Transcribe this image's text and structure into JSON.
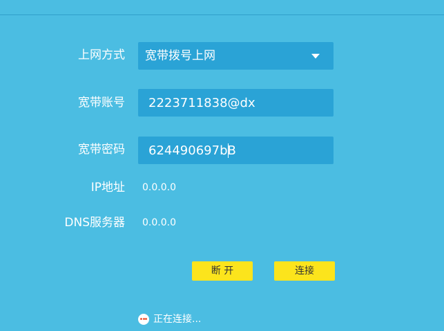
{
  "form": {
    "connection_type": {
      "label": "上网方式",
      "value": "宽带拨号上网"
    },
    "account": {
      "label": "宽带账号",
      "value": "2223711838@dx"
    },
    "password": {
      "label": "宽带密码",
      "value": "624490697bB"
    },
    "ip": {
      "label": "IP地址",
      "value": "0.0.0.0"
    },
    "dns": {
      "label": "DNS服务器",
      "value": "0.0.0.0"
    }
  },
  "buttons": {
    "disconnect_label": "断 开",
    "connect_label": "连接"
  },
  "status": {
    "text": "正在连接...",
    "icon": "ellipsis-icon"
  },
  "colors": {
    "background": "#4bbde2",
    "field_background": "#2aa3d6",
    "button": "#fce41c",
    "status_dots": "#ef5b3a"
  }
}
